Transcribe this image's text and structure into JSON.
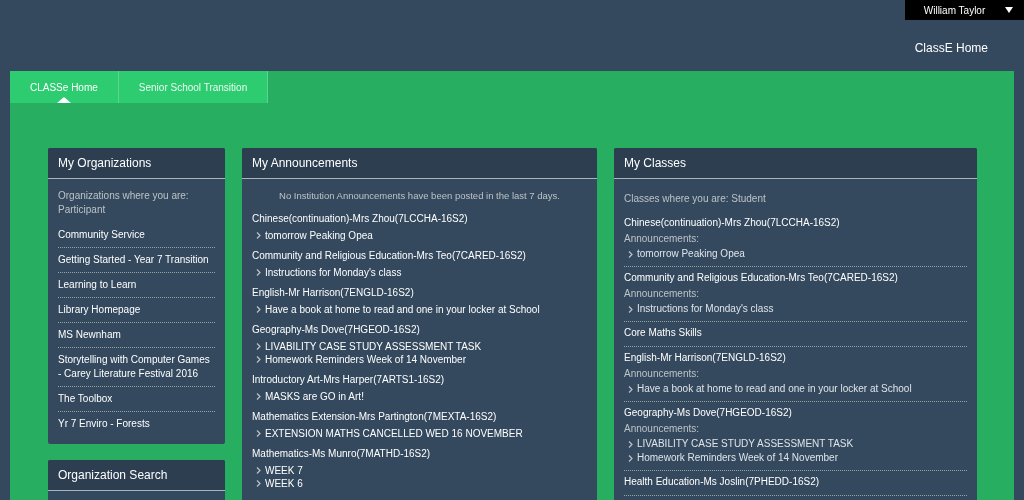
{
  "user_menu": {
    "name": "William Taylor"
  },
  "header_link": "ClassE Home",
  "tabs": [
    {
      "label": "CLASSe Home",
      "selected": true
    },
    {
      "label": "Senior School Transition",
      "selected": false
    }
  ],
  "organizations": {
    "title": "My Organizations",
    "intro": "Organizations where you are: Participant",
    "items": [
      "Community Service",
      "Getting Started - Year 7 Transition",
      "Learning to Learn",
      "Library Homepage",
      "MS Newnham",
      "Storytelling with Computer Games - Carey Literature Festival 2016",
      "The Toolbox",
      "Yr 7 Enviro - Forests"
    ]
  },
  "organization_search": {
    "title": "Organization Search"
  },
  "announcements": {
    "title": "My Announcements",
    "notice": "No Institution Announcements have been posted in the last 7 days.",
    "groups": [
      {
        "class": "Chinese(continuation)-Mrs Zhou(7LCCHA-16S2)",
        "items": [
          "tomorrow Peaking Opea"
        ]
      },
      {
        "class": "Community and Religious Education-Mrs Teo(7CARED-16S2)",
        "items": [
          "Instructions for Monday's class"
        ]
      },
      {
        "class": "English-Mr Harrison(7ENGLD-16S2)",
        "items": [
          "Have a book at home to read and one in your locker at School"
        ]
      },
      {
        "class": "Geography-Ms Dove(7HGEOD-16S2)",
        "items": [
          "LIVABILITY CASE STUDY ASSESSMENT TASK",
          "Homework Reminders Week of 14 November"
        ]
      },
      {
        "class": "Introductory Art-Mrs Harper(7ARTS1-16S2)",
        "items": [
          "MASKS are GO in Art!"
        ]
      },
      {
        "class": "Mathematics Extension-Mrs Partington(7MEXTA-16S2)",
        "items": [
          "EXTENSION MATHS CANCELLED WED 16 NOVEMBER"
        ]
      },
      {
        "class": "Mathematics-Ms Munro(7MATHD-16S2)",
        "items": [
          "WEEK 7",
          "WEEK 6"
        ]
      }
    ]
  },
  "classes": {
    "title": "My Classes",
    "intro": "Classes where you are: Student",
    "items": [
      {
        "name": "Chinese(continuation)-Mrs Zhou(7LCCHA-16S2)",
        "label": "Announcements:",
        "announcements": [
          "tomorrow Peaking Opea"
        ]
      },
      {
        "name": "Community and Religious Education-Mrs Teo(7CARED-16S2)",
        "label": "Announcements:",
        "announcements": [
          "Instructions for Monday's class"
        ]
      },
      {
        "name": "Core Maths Skills"
      },
      {
        "name": "English-Mr Harrison(7ENGLD-16S2)",
        "label": "Announcements:",
        "announcements": [
          "Have a book at home to read and one in your locker at School"
        ]
      },
      {
        "name": "Geography-Ms Dove(7HGEOD-16S2)",
        "label": "Announcements:",
        "announcements": [
          "LIVABILITY CASE STUDY ASSESSMENT TASK",
          "Homework Reminders Week of 14 November"
        ]
      },
      {
        "name": "Health Education-Ms Joslin(7PHEDD-16S2)"
      }
    ]
  }
}
